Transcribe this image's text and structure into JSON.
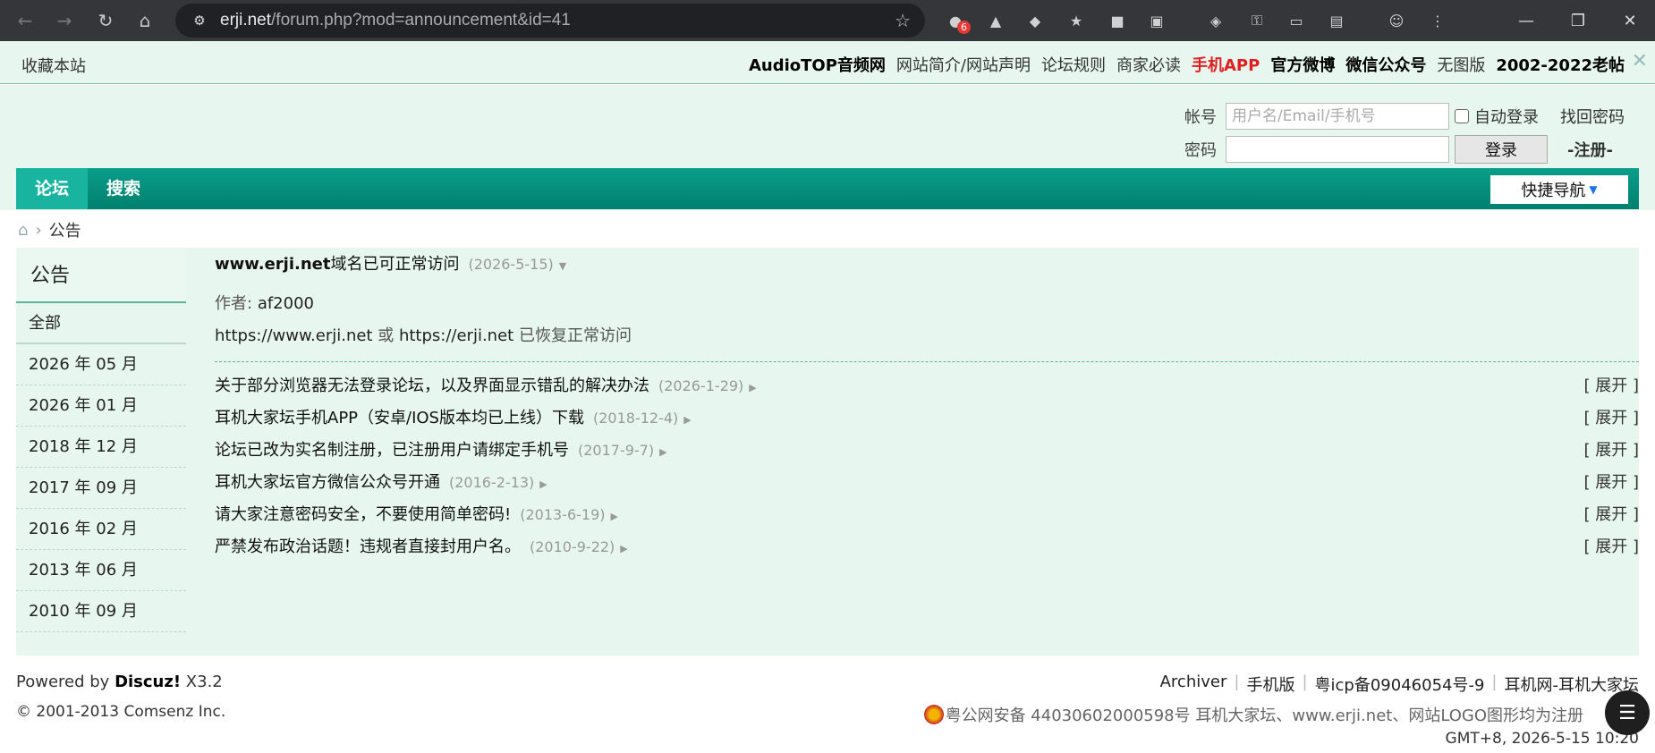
{
  "browser": {
    "url_host": "erji.net",
    "url_path": "/forum.php?mod=announcement&id=41",
    "extension_badge": "6"
  },
  "topbar": {
    "bookmark": "收藏本站",
    "links": [
      {
        "text": "AudioTOP音频网",
        "style": "bold"
      },
      {
        "text": "网站简介/网站声明",
        "style": "plain"
      },
      {
        "text": "论坛规则",
        "style": "plain"
      },
      {
        "text": "商家必读",
        "style": "plain"
      },
      {
        "text": "手机APP",
        "style": "red"
      },
      {
        "text": "官方微博",
        "style": "bold"
      },
      {
        "text": "微信公众号",
        "style": "bold"
      },
      {
        "text": "无图版",
        "style": "plain"
      },
      {
        "text": "2002-2022老帖",
        "style": "bold"
      }
    ]
  },
  "login": {
    "account_label": "帐号",
    "account_placeholder": "用户名/Email/手机号",
    "remember_label": "自动登录",
    "forgot": "找回密码",
    "password_label": "密码",
    "login_button": "登录",
    "register": "-注册-"
  },
  "nav": {
    "items": [
      "论坛",
      "搜索"
    ],
    "quick_nav": "快捷导航"
  },
  "breadcrumb": {
    "current": "公告"
  },
  "sidebar": {
    "title": "公告",
    "items": [
      "全部",
      "2026 年 05 月",
      "2026 年 01 月",
      "2018 年 12 月",
      "2017 年 09 月",
      "2016 年 02 月",
      "2013 年 06 月",
      "2010 年 09 月"
    ]
  },
  "announcement": {
    "title_bold": "www.erji.net",
    "title_rest": "域名已可正常访问",
    "date": "(2026-5-15)",
    "author_label": "作者:",
    "author": "af2000",
    "body_a": "https://www.erji.net",
    "body_mid": " 或 ",
    "body_b": "https://erji.net",
    "body_tail": " 已恢复正常访问"
  },
  "list": [
    {
      "title": "关于部分浏览器无法登录论坛，以及界面显示错乱的解决办法",
      "date": "(2026-1-29)",
      "expand": "[ 展开 ]"
    },
    {
      "title": "耳机大家坛手机APP（安卓/IOS版本均已上线）下载",
      "date": "(2018-12-4)",
      "expand": "[ 展开 ]"
    },
    {
      "title": "论坛已改为实名制注册，已注册用户请绑定手机号",
      "date": "(2017-9-7)",
      "expand": "[ 展开 ]"
    },
    {
      "title": "耳机大家坛官方微信公众号开通",
      "date": "(2016-2-13)",
      "expand": "[ 展开 ]"
    },
    {
      "title": "请大家注意密码安全，不要使用简单密码!",
      "date": "(2013-6-19)",
      "expand": "[ 展开 ]"
    },
    {
      "title": "严禁发布政治话题！违规者直接封用户名。",
      "date": "(2010-9-22)",
      "expand": "[ 展开 ]"
    }
  ],
  "footer": {
    "powered_prefix": "Powered by",
    "powered_brand": "Discuz!",
    "powered_version": "X3.2",
    "copyright": "© 2001-2013 Comsenz Inc.",
    "links": [
      "Archiver",
      "手机版",
      "粤icp备09046054号-9",
      "耳机网-耳机大家坛"
    ],
    "icp_line": "粤公网安备 44030602000598号 耳机大家坛、www.erji.net、网站LOGO图形均为注册",
    "time": "GMT+8, 2026-5-15 10:20"
  }
}
